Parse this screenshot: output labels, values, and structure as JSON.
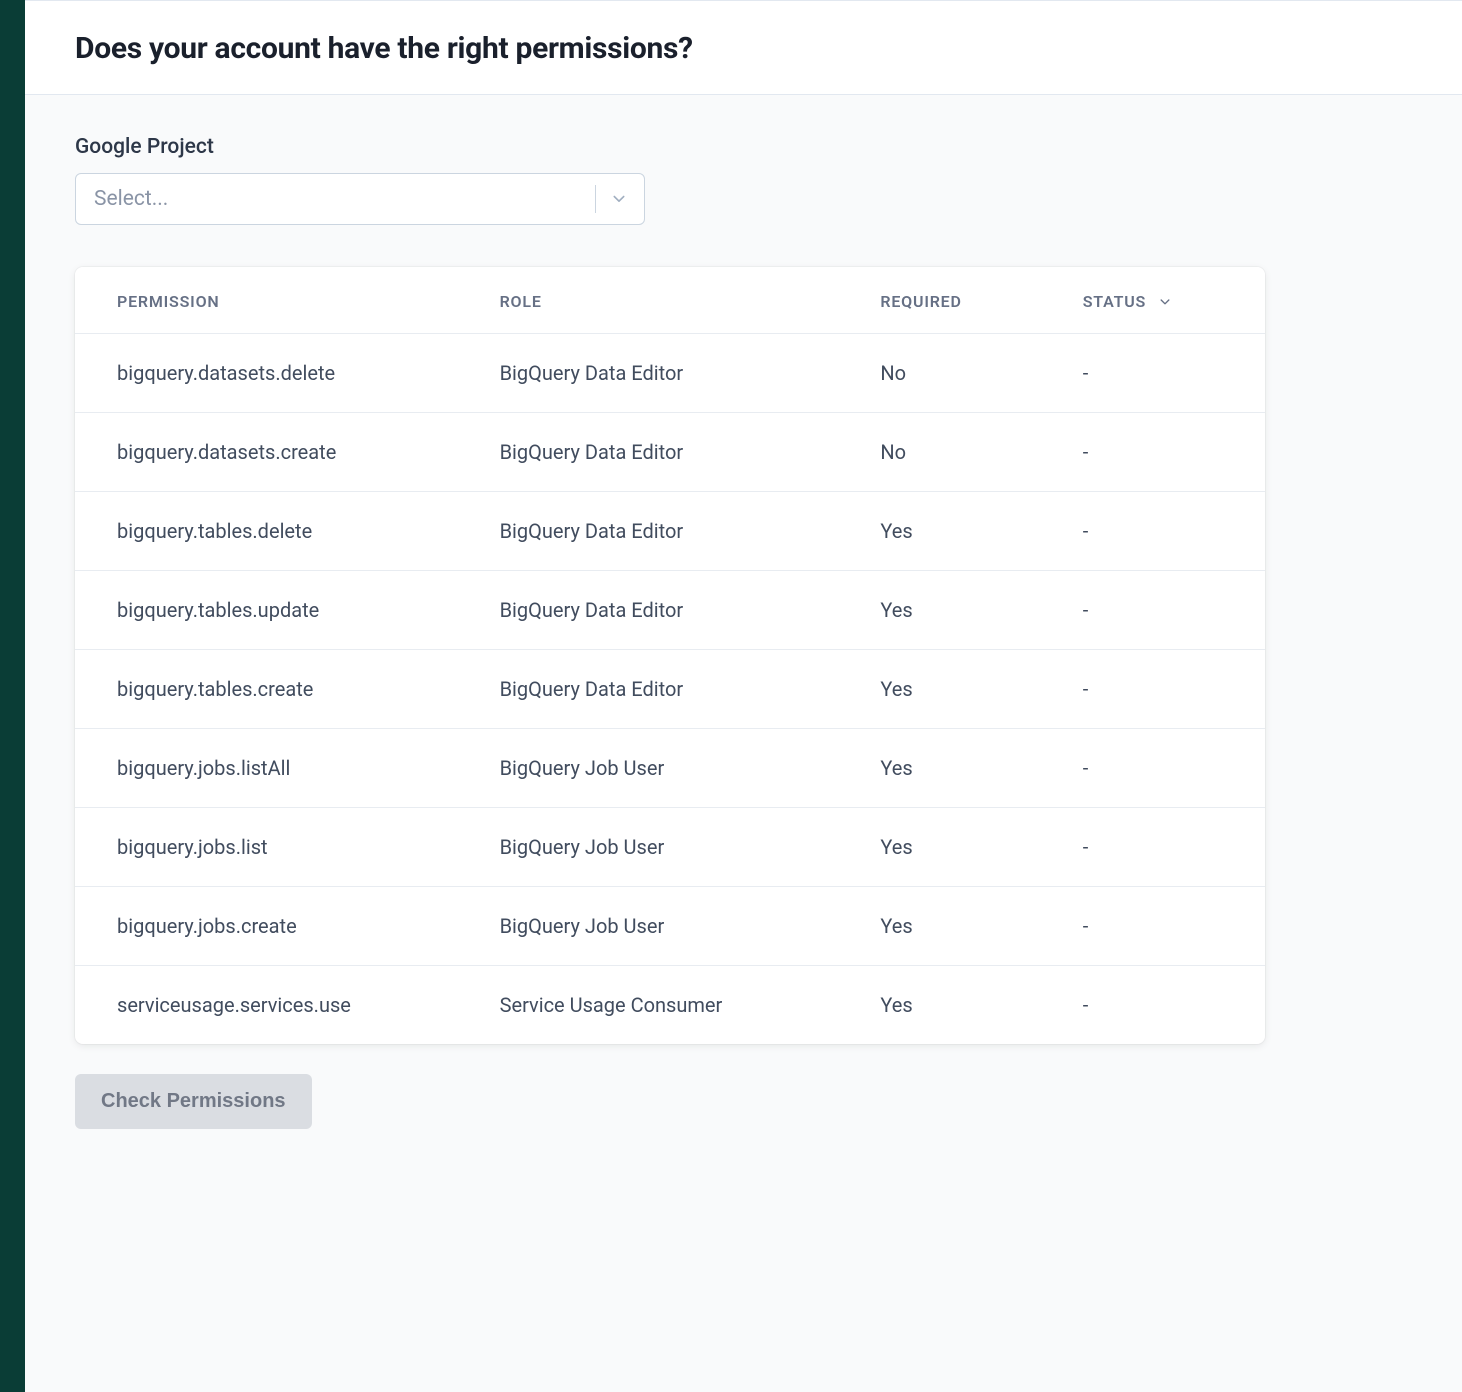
{
  "header": {
    "title": "Does your account have the right permissions?"
  },
  "project_select": {
    "label": "Google Project",
    "placeholder": "Select..."
  },
  "table": {
    "headers": {
      "permission": "PERMISSION",
      "role": "ROLE",
      "required": "REQUIRED",
      "status": "STATUS"
    },
    "rows": [
      {
        "permission": "bigquery.datasets.delete",
        "role": "BigQuery Data Editor",
        "required": "No",
        "status": "-"
      },
      {
        "permission": "bigquery.datasets.create",
        "role": "BigQuery Data Editor",
        "required": "No",
        "status": "-"
      },
      {
        "permission": "bigquery.tables.delete",
        "role": "BigQuery Data Editor",
        "required": "Yes",
        "status": "-"
      },
      {
        "permission": "bigquery.tables.update",
        "role": "BigQuery Data Editor",
        "required": "Yes",
        "status": "-"
      },
      {
        "permission": "bigquery.tables.create",
        "role": "BigQuery Data Editor",
        "required": "Yes",
        "status": "-"
      },
      {
        "permission": "bigquery.jobs.listAll",
        "role": "BigQuery Job User",
        "required": "Yes",
        "status": "-"
      },
      {
        "permission": "bigquery.jobs.list",
        "role": "BigQuery Job User",
        "required": "Yes",
        "status": "-"
      },
      {
        "permission": "bigquery.jobs.create",
        "role": "BigQuery Job User",
        "required": "Yes",
        "status": "-"
      },
      {
        "permission": "serviceusage.services.use",
        "role": "Service Usage Consumer",
        "required": "Yes",
        "status": "-"
      }
    ]
  },
  "buttons": {
    "check": "Check Permissions"
  }
}
